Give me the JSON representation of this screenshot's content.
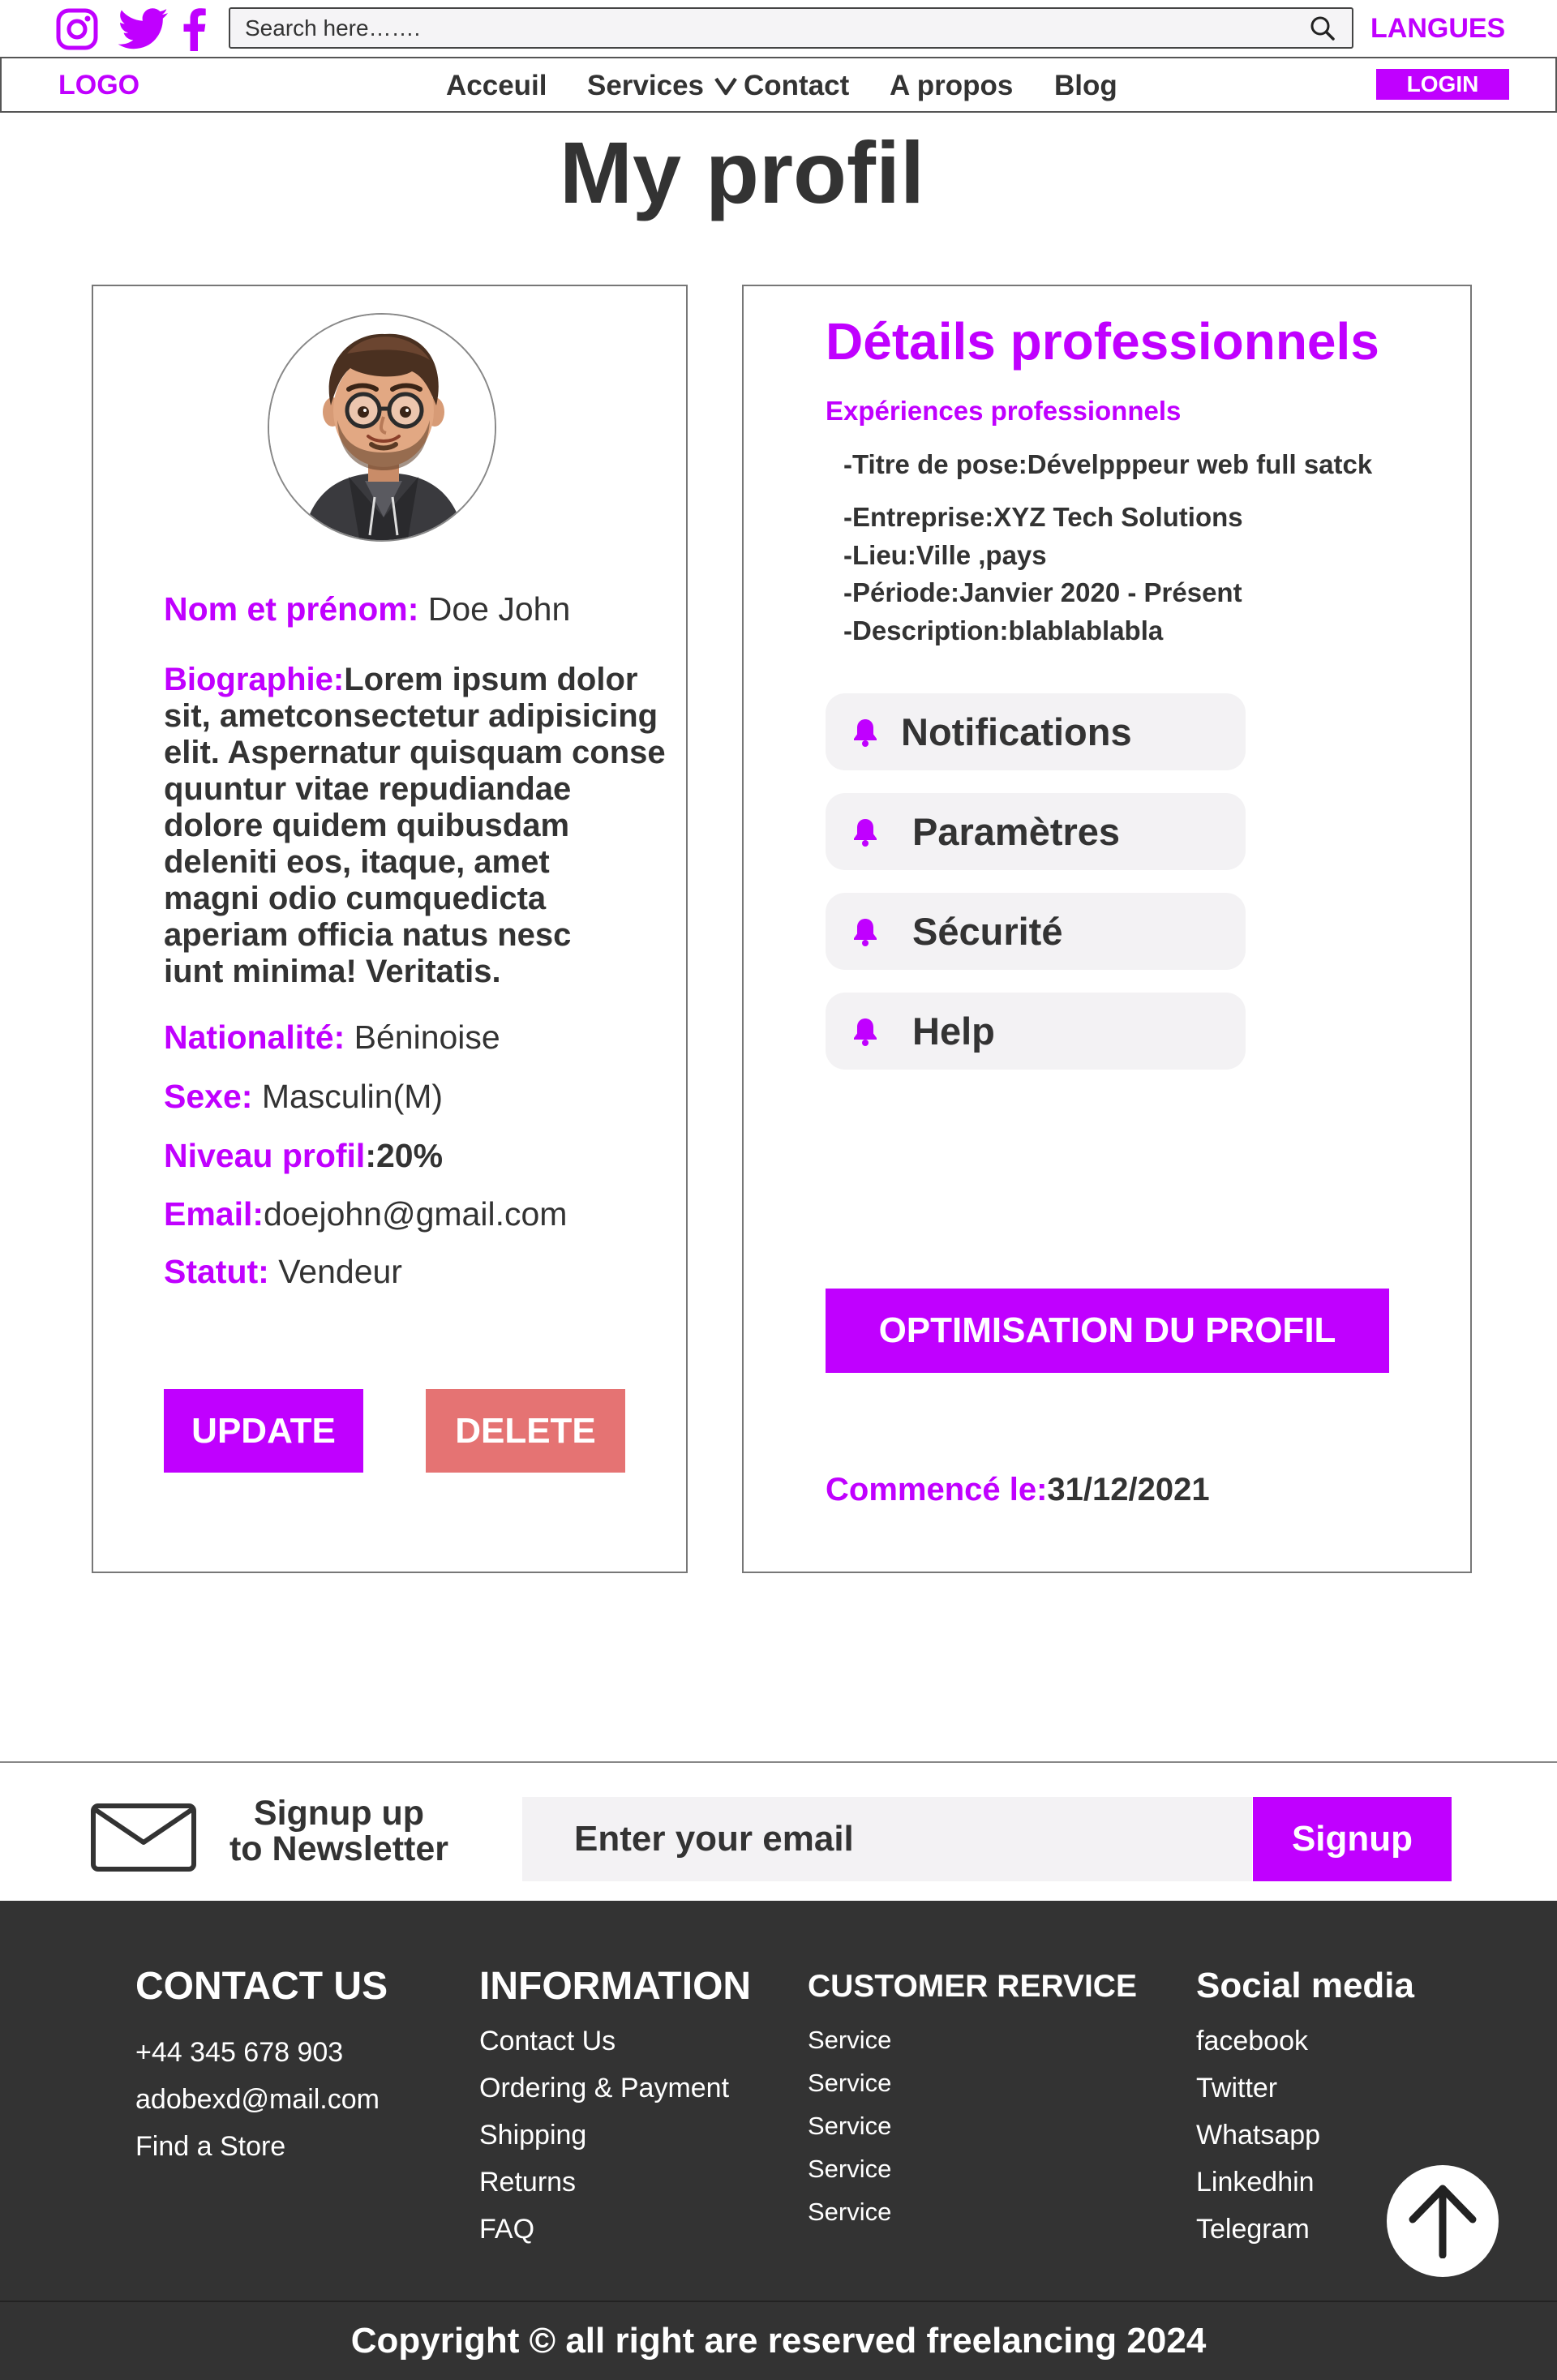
{
  "header": {
    "search_placeholder": "Search here…….",
    "langues": "LANGUES",
    "logo": "LOGO",
    "nav": [
      "Acceuil",
      "Services",
      "Contact",
      "A propos",
      "Blog"
    ],
    "login": "LOGIN"
  },
  "page_title": "My profil",
  "profile": {
    "name_label": "Nom et prénom:",
    "name_value": "Doe John",
    "bio_label": "Biographie:",
    "bio_text": "Lorem ipsum dolor\nsit, ametconsectetur adipisicing\nelit. Aspernatur quisquam conse\nquuntur vitae repudiandae\ndolore quidem quibusdam\ndeleniti eos, itaque, amet\nmagni odio cumquedicta\naperiam officia natus nesc\niunt minima! Veritatis.",
    "nationality_label": "Nationalité:",
    "nationality_value": " Béninoise",
    "sex_label": "Sexe:",
    "sex_value": " Masculin(M)",
    "level_label": "Niveau profil",
    "level_value": ":20%",
    "email_label": "Email:",
    "email_value": "doejohn@gmail.com",
    "status_label": "Statut:",
    "status_value": " Vendeur",
    "update": "UPDATE",
    "delete": "DELETE"
  },
  "professional": {
    "title": "Détails professionnels",
    "subtitle": "Expériences professionnels",
    "lines": [
      "-Titre de pose:Dévelpppeur web full satck",
      "-Entreprise:XYZ Tech Solutions",
      "-Lieu:Ville ,pays",
      "-Période:Janvier 2020 - Présent",
      "-Description:blablablabla"
    ],
    "menu": [
      "Notifications",
      "Paramètres",
      "Sécurité",
      "Help"
    ],
    "optimize": "OPTIMISATION DU PROFIL",
    "started_label": "Commencé le:",
    "started_value": "31/12/2021"
  },
  "newsletter": {
    "title": "Signup up\nto Newsletter",
    "placeholder": "Enter your email",
    "button": "Signup"
  },
  "footer": {
    "contact": {
      "title": "CONTACT US",
      "items": [
        "+44 345 678 903",
        "adobexd@mail.com",
        "Find a Store"
      ]
    },
    "information": {
      "title": "INFORMATION",
      "items": [
        "Contact Us",
        "Ordering & Payment",
        "Shipping",
        "Returns",
        "FAQ"
      ]
    },
    "customer": {
      "title": "CUSTOMER RERVICE",
      "items": [
        "Service",
        "Service",
        "Service",
        "Service",
        "Service"
      ]
    },
    "social": {
      "title": "Social media",
      "items": [
        "facebook",
        "Twitter",
        "Whatsapp",
        "Linkedhin",
        "Telegram"
      ]
    },
    "copyright": "Copyright © all right are reserved freelancing 2024"
  },
  "colors": {
    "accent": "#c000ff",
    "delete": "#e57373",
    "footer_bg": "#333333",
    "text": "#333333"
  },
  "icons": [
    "instagram-icon",
    "twitter-icon",
    "facebook-icon",
    "search-icon",
    "chevron-down-icon",
    "bell-icon",
    "envelope-icon",
    "arrow-up-icon"
  ]
}
